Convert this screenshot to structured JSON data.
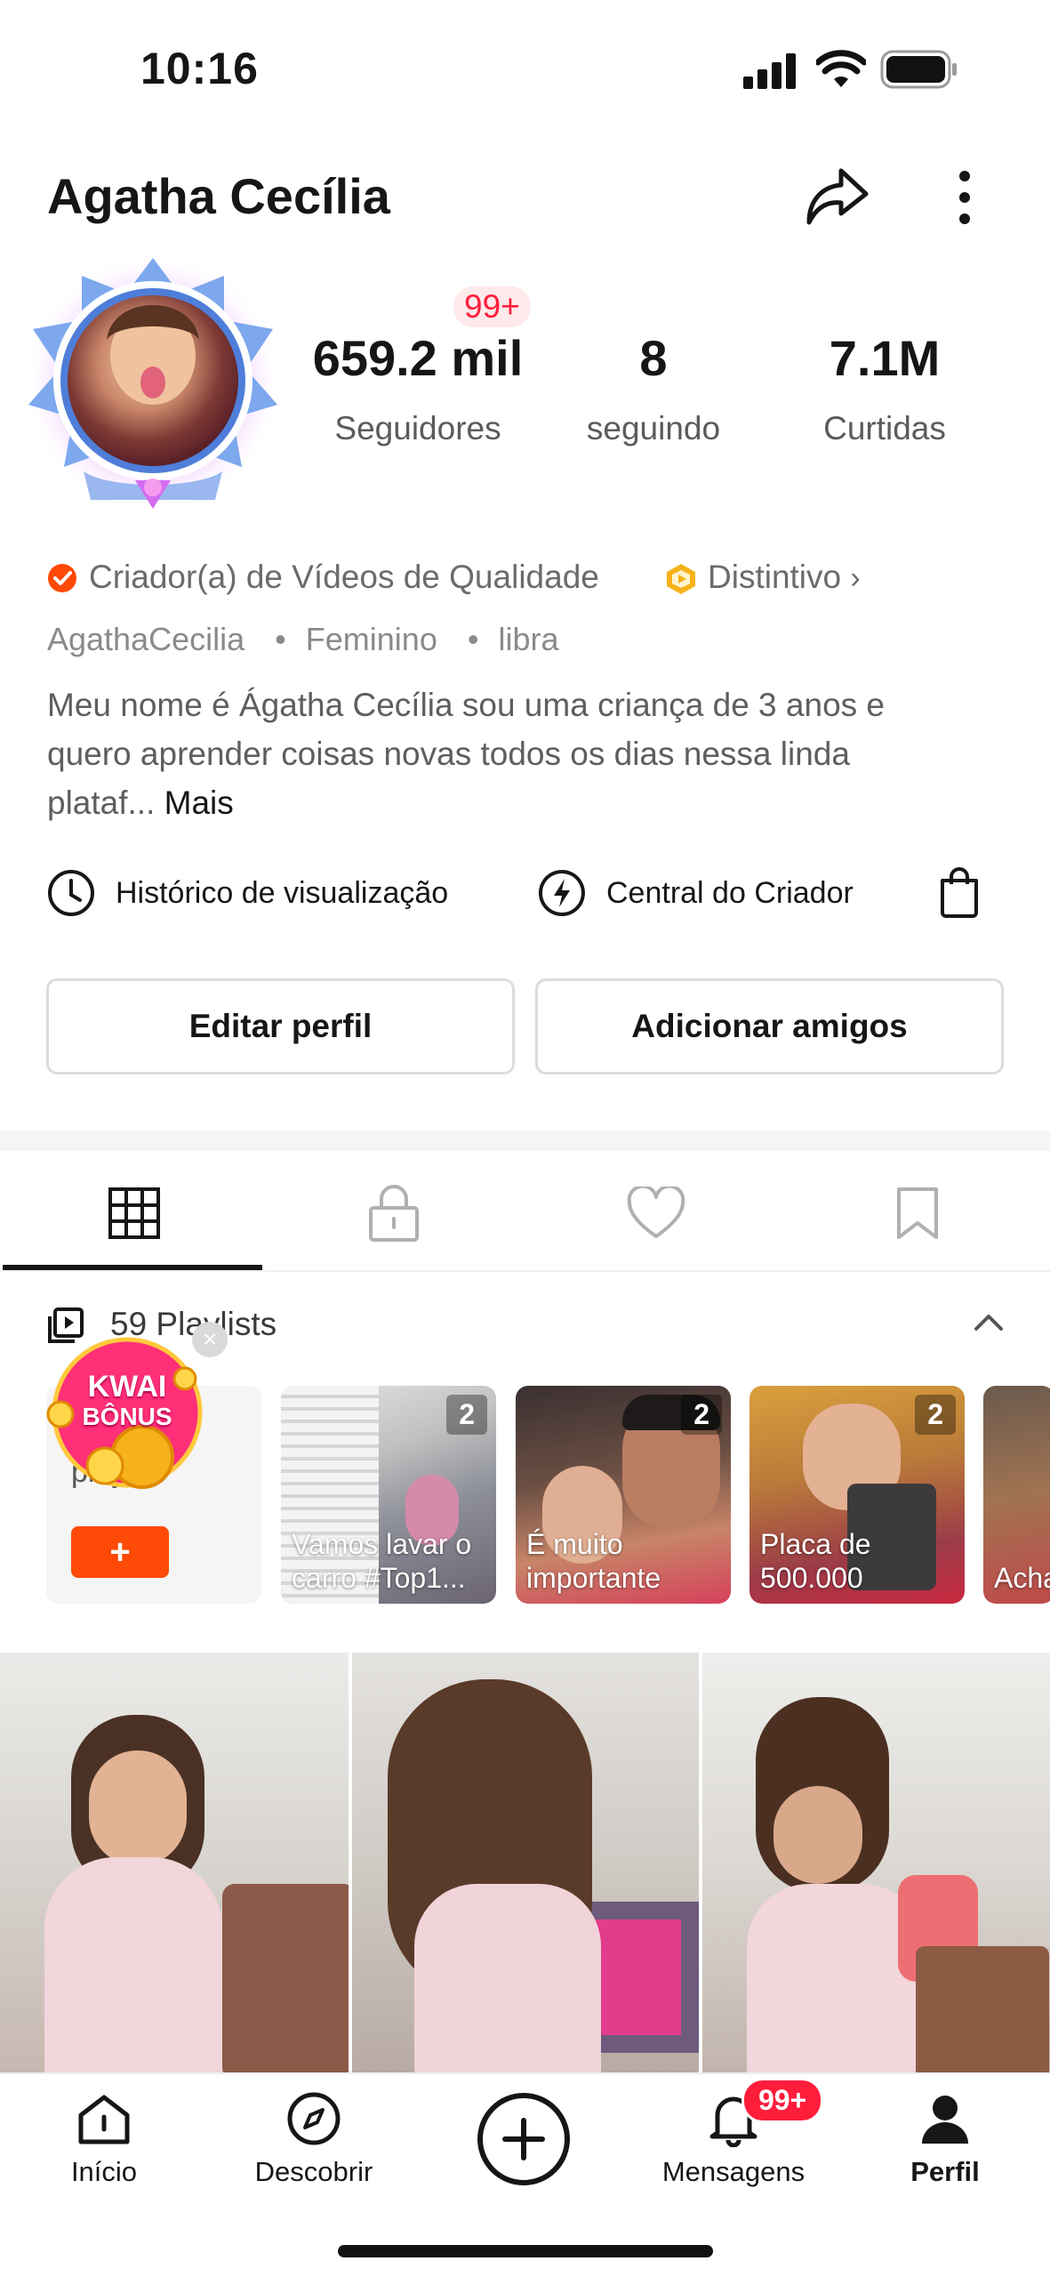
{
  "status_bar": {
    "time": "10:16"
  },
  "profile": {
    "name": "Agatha Cecília",
    "followers_badge": "99+",
    "stats": [
      {
        "value": "659.2 mil",
        "label": "Seguidores"
      },
      {
        "value": "8",
        "label": "seguindo"
      },
      {
        "value": "7.1M",
        "label": "Curtidas"
      }
    ],
    "creator_tag": "Criador(a) de Vídeos de Qualidade",
    "badge_link": "Distintivo",
    "meta": {
      "handle": "AgathaCecilia",
      "gender": "Feminino",
      "sign": "libra"
    },
    "bio": "Meu nome é Ágatha Cecília sou uma criança de 3 anos e quero aprender coisas novas todos os dias nessa linda plataf...",
    "bio_more": "Mais"
  },
  "shortcuts": {
    "history": "Histórico de visualização",
    "creator_center": "Central do Criador"
  },
  "buttons": {
    "edit": "Editar perfil",
    "add_friends": "Adicionar amigos"
  },
  "playlists": {
    "header": "59 Playlists",
    "create_text": "playlist",
    "create_button": "+",
    "kwai_bonus": [
      "KWAI",
      "BÔNUS"
    ],
    "items": [
      {
        "title": "Vamos lavar o carro #Top1...",
        "count": "2"
      },
      {
        "title": "É muito importante",
        "count": "2"
      },
      {
        "title": "Placa de 500.000",
        "count": "2"
      },
      {
        "title": "Acha na K",
        "count": ""
      }
    ]
  },
  "nav": {
    "home": "Início",
    "discover": "Descobrir",
    "messages": "Mensagens",
    "messages_badge": "99+",
    "profile": "Perfil"
  },
  "colors": {
    "accent": "#ff4906",
    "badge_red": "#ff1d3c",
    "gold": "#f6b21a"
  }
}
